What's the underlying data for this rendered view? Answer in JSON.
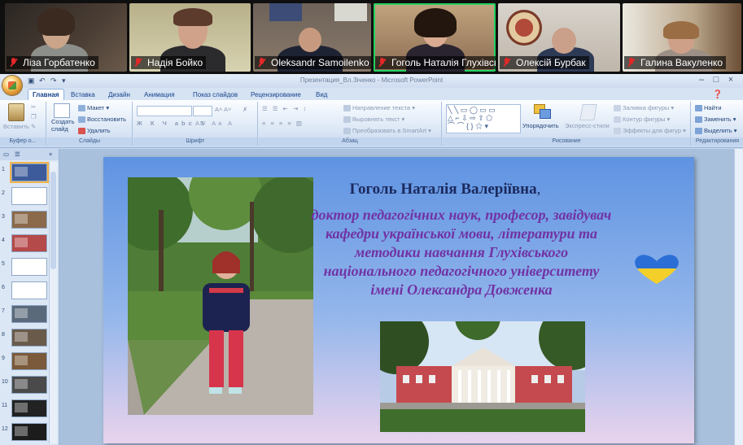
{
  "participants": [
    {
      "name": "Ліза Горбатенко",
      "muted": true,
      "active": false
    },
    {
      "name": "Надія Бойко",
      "muted": true,
      "active": false
    },
    {
      "name": "Oleksandr Samoilenko",
      "muted": true,
      "active": false
    },
    {
      "name": "Гоголь Наталія Глухівсь...",
      "muted": true,
      "active": true
    },
    {
      "name": "Олексій Бурбак",
      "muted": true,
      "active": false
    },
    {
      "name": "Галина Вакуленко",
      "muted": true,
      "active": false
    }
  ],
  "window": {
    "title": "Презентация_Вл.Зіченко - Microsoft PowerPoint",
    "controls": [
      "–",
      "□",
      "×"
    ]
  },
  "ribbon": {
    "tabs": [
      "Главная",
      "Вставка",
      "Дизайн",
      "Анимация",
      "Показ слайдов",
      "Рецензирование",
      "Вид"
    ],
    "active_tab": "Главная",
    "clipboard": {
      "paste": "Вставить",
      "label": "Буфер о..."
    },
    "slides": {
      "new_slide": "Создать слайд",
      "layout": "Макет",
      "reset": "Восстановить",
      "delete": "Удалить",
      "label": "Слайды"
    },
    "font": {
      "label": "Шрифт"
    },
    "paragraph": {
      "text_direction": "Направление текста",
      "align_text": "Выровнять текст",
      "smartart": "Преобразовать в SmartArt",
      "label": "Абзац"
    },
    "drawing": {
      "arrange": "Упорядочить",
      "quick_styles": "Экспресс-стили",
      "fill": "Заливка фигуры",
      "outline": "Контур фигуры",
      "effects": "Эффекты для фигур",
      "label": "Рисование"
    },
    "editing": {
      "find": "Найти",
      "replace": "Заменить",
      "select": "Выделить",
      "label": "Редактирования"
    }
  },
  "thumbnails": {
    "numbers": [
      "1",
      "2",
      "3",
      "4",
      "5",
      "6",
      "7",
      "8",
      "9",
      "10",
      "11",
      "12"
    ],
    "selected": "1"
  },
  "slide": {
    "title": "Гоголь Наталія Валеріївна",
    "title_suffix": ",",
    "description": "доктор педагогічних наук, професор, завідувач кафедри української мови, літератури та методики навчання Глухівського національного педагогічного університету імені Олександра Довженка"
  },
  "colors": {
    "active_speaker": "#23d160",
    "muted_mic": "#e02828",
    "title_text": "#1b2a5e",
    "desc_text": "#7132a4",
    "heart_top": "#2b6fd6",
    "heart_bottom": "#f4cf2a"
  }
}
